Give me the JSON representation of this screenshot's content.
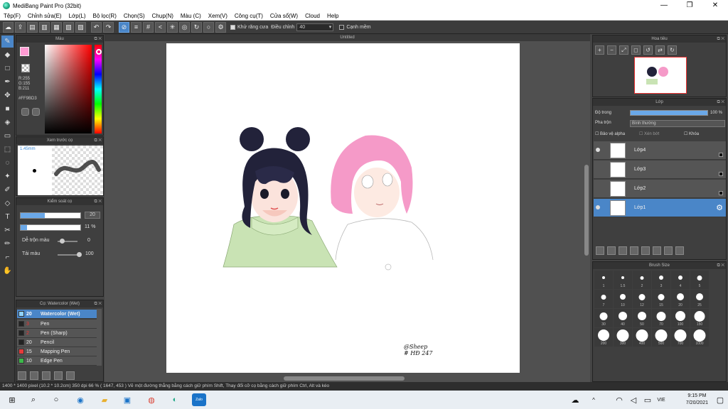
{
  "window": {
    "title": "MediBang Paint Pro (32bit)",
    "minimize": "—",
    "maximize": "❐",
    "close": "✕"
  },
  "menu": [
    "Tệp(F)",
    "Chỉnh sửa(E)",
    "Lớp(L)",
    "Bộ lọc(R)",
    "Chọn(S)",
    "Chụp(N)",
    "Màu (C)",
    "Xem(V)",
    "Công cụ(T)",
    "Cửa sổ(W)",
    "Cloud",
    "Help"
  ],
  "toolbar": {
    "antialias_label": "Khử răng cưa",
    "adjust_label": "Điều chỉnh",
    "adjust_value": "40",
    "edge_label": "Cạnh mềm"
  },
  "color_panel": {
    "title": "Màu",
    "rgb": "R:255\nG:155\nB:211",
    "hex": "#FF9BD3",
    "foreground": "#ff9bd3"
  },
  "preview_panel": {
    "title": "Xem trước cọ",
    "size": "1.45mm"
  },
  "control_panel": {
    "title": "Kiểm soát cọ",
    "size_value": "20",
    "opacity_value": "11 %",
    "blend_label": "Dễ trộn màu",
    "blend_value": "0",
    "load_label": "Tải màu",
    "load_value": "100"
  },
  "brush_panel": {
    "title": "Cọ: Watercolor (Wet)",
    "items": [
      {
        "size": "20",
        "name": "Watercolor (Wet)",
        "color": "#8fd3ff"
      },
      {
        "size": "3",
        "name": "Pen",
        "color": "#222222"
      },
      {
        "size": "2",
        "name": "Pen (Sharp)",
        "color": "#222222"
      },
      {
        "size": "20",
        "name": "Pencil",
        "color": "#222222"
      },
      {
        "size": "15",
        "name": "Mapping Pen",
        "color": "#e53b3b"
      },
      {
        "size": "10",
        "name": "Edge Pen",
        "color": "#3cb84a"
      }
    ]
  },
  "canvas": {
    "tab": "Untitled",
    "signature_line1": "@Sheep",
    "signature_line2": "# HĐ 247"
  },
  "navigator": {
    "title": "Hoa tiêu"
  },
  "layers": {
    "title": "Lớp",
    "opacity_label": "Độ trong",
    "opacity_value": "100 %",
    "opacity_fraction": 1.0,
    "blend_label": "Pha trộn",
    "blend_value": "Bình thường",
    "protect_alpha": "Bảo vệ alpha",
    "clipping": "Xén bớt",
    "lock": "Khóa",
    "items": [
      {
        "name": "Lớp4",
        "visible": true,
        "selected": false
      },
      {
        "name": "Lớp3",
        "visible": false,
        "selected": false
      },
      {
        "name": "Lớp2",
        "visible": false,
        "selected": false
      },
      {
        "name": "Lớp1",
        "visible": true,
        "selected": true
      }
    ]
  },
  "brush_size": {
    "title": "Brush Size",
    "values": [
      "1",
      "1.5",
      "2",
      "3",
      "4",
      "5",
      "7",
      "10",
      "12",
      "15",
      "20",
      "25",
      "30",
      "40",
      "50",
      "70",
      "100",
      "150",
      "200",
      "300",
      "400",
      "500",
      "700",
      "1000"
    ]
  },
  "status": "1400 * 1400 pixel   (10.2 * 10.2cm)   350 dpi   66 %   ( 1647, 453 )   Vẽ một đường thẳng bằng cách giữ phím Shift, Thay đổi cỡ cọ bằng cách giữ phím Ctrl, Alt và kéo",
  "taskbar": {
    "lang": "VIE",
    "time": "9:15 PM",
    "date": "7/20/2021",
    "zalo": "Zalo"
  }
}
